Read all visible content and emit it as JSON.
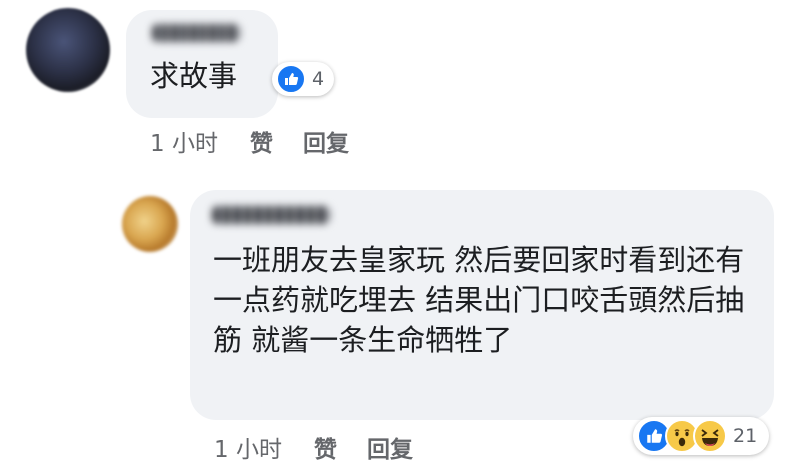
{
  "comments": [
    {
      "text": "求故事",
      "reaction_count": "4",
      "time": "1 小时",
      "like_label": "赞",
      "reply_label": "回复"
    },
    {
      "text": "一班朋友去皇家玩 然后要回家时看到还有一点药就吃埋去 结果出门口咬舌頭然后抽筋 就酱一条生命牺牲了",
      "reaction_count": "21",
      "time": "1 小时",
      "like_label": "赞",
      "reply_label": "回复"
    }
  ],
  "colors": {
    "bubble": "#f0f2f5",
    "like_blue": "#1877f2",
    "emoji_yellow": "#f7c948",
    "meta_gray": "#65676b"
  }
}
